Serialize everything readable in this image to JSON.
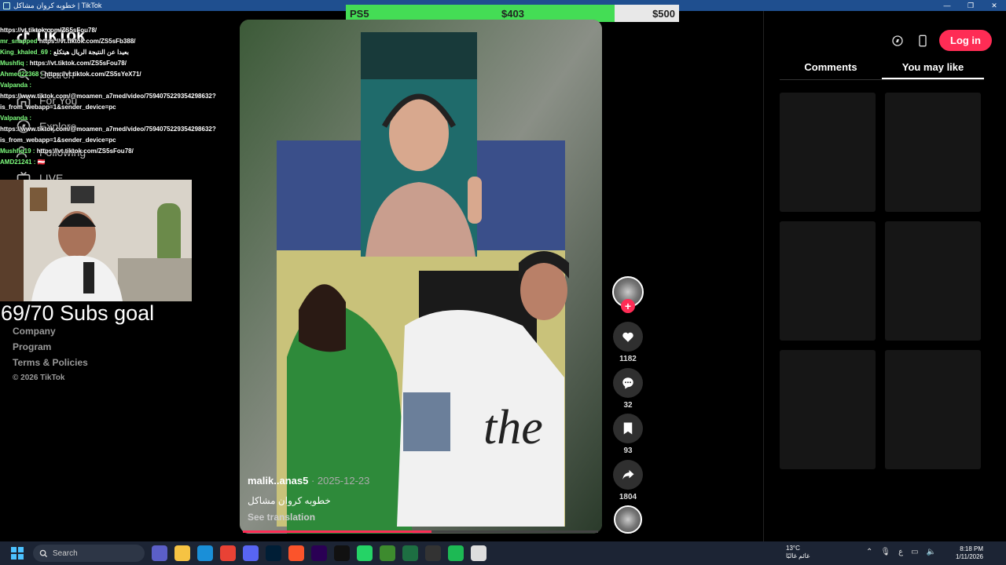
{
  "window": {
    "title": "خطوبه كروان مشاكل | TikTok",
    "controls": [
      "—",
      "❐",
      "✕"
    ]
  },
  "goal_bar": {
    "name": "PS5",
    "current": "$403",
    "target": "$500",
    "progress": 0.806,
    "fill_color": "#44dd55"
  },
  "logo": {
    "text": "TikTok"
  },
  "nav": [
    {
      "label": "Search",
      "icon": "search-icon"
    },
    {
      "label": "For You",
      "icon": "home-icon"
    },
    {
      "label": "Explore",
      "icon": "compass-icon"
    },
    {
      "label": "Following",
      "icon": "following-icon"
    },
    {
      "label": "LIVE",
      "icon": "live-icon"
    }
  ],
  "chat": [
    {
      "user": "",
      "msg": "https://vt.tiktok.com/ZS5sFou78/"
    },
    {
      "user": "mr_snapped",
      "msg": "https://vt.tiktok.com/ZS5sFb388/"
    },
    {
      "user": "King_khaled_69 :",
      "msg": "بعيدا عن النتيجة الريال هيتكلع"
    },
    {
      "user": "Mushfiq :",
      "msg": "https://vt.tiktok.com/ZS5sFou78/"
    },
    {
      "user": "Ahmed22368 :",
      "msg": "https://vt.tiktok.com/ZS5sYeX71/"
    },
    {
      "user": "Valpanda :",
      "msg": ""
    },
    {
      "user": "",
      "msg": "https://www.tiktok.com/@moamen_a7med/video/7594075229354298632?"
    },
    {
      "user": "",
      "msg": "is_from_webapp=1&sender_device=pc"
    },
    {
      "user": "Valpanda :",
      "msg": ""
    },
    {
      "user": "",
      "msg": "https://www.tiktok.com/@moamen_a7med/video/7594075229354298632?"
    },
    {
      "user": "",
      "msg": "is_from_webapp=1&sender_device=pc"
    },
    {
      "user": "Mushfiq19 :",
      "msg": "https://vt.tiktok.com/ZS5sFou78/"
    },
    {
      "user": "AMD21241 :",
      "msg": "🇦🇹"
    }
  ],
  "subs_goal": "69/70 Subs goal",
  "footer": {
    "company": "Company",
    "program": "Program",
    "terms": "Terms & Policies",
    "copyright": "© 2026 TikTok"
  },
  "video": {
    "author": "malik..anas5",
    "date": " · 2025-12-23",
    "caption": "خطوبه كروان مشاكل",
    "see_translation": "See translation",
    "progress": 0.53
  },
  "actions": {
    "likes": "1182",
    "comments": "32",
    "saves": "93",
    "shares": "1804"
  },
  "right_panel": {
    "login": "Log in",
    "tabs": [
      "Comments",
      "You may like"
    ],
    "active_tab": "You may like",
    "thumb_count": 6
  },
  "taskbar": {
    "search": "Search",
    "weather_temp": "13°C",
    "weather_desc": "غائم غالبًا",
    "time": "8:18 PM",
    "date": "1/11/2026",
    "lang": "ع",
    "apps": [
      "teams-icon",
      "explorer-icon",
      "edge-icon",
      "chrome-icon",
      "discord-icon",
      "photoshop-icon",
      "brave-icon",
      "premiere-icon",
      "capcut-icon",
      "whatsapp-icon",
      "minecraft-icon",
      "excel-icon",
      "obs-icon",
      "spotify-icon",
      "misc-icon"
    ]
  },
  "colors": {
    "accent": "#fe2c55",
    "taskbar": "#1c2434",
    "titlebar": "#1f4f8f"
  }
}
